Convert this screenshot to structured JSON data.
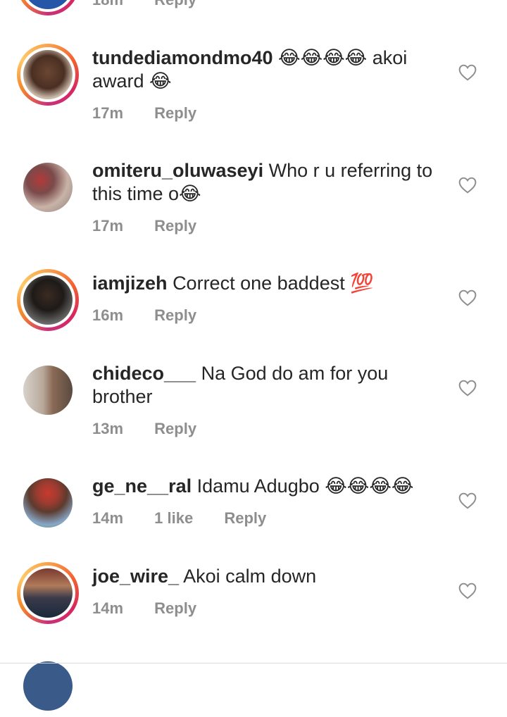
{
  "top_partial": {
    "time": "18m",
    "reply": "Reply"
  },
  "comments": [
    {
      "user": "tundediamondmo40",
      "text": "😂😂😂😂 akoi award 😂",
      "time": "17m",
      "likes": "",
      "reply": "Reply",
      "story": true
    },
    {
      "user": "omiteru_oluwaseyi",
      "text": "Who r u referring to this time o😂",
      "time": "17m",
      "likes": "",
      "reply": "Reply",
      "story": false
    },
    {
      "user": "iamjizeh",
      "text": "Correct one baddest 💯",
      "time": "16m",
      "likes": "",
      "reply": "Reply",
      "story": true
    },
    {
      "user": "chideco___",
      "text": "Na God do am for you brother",
      "time": "13m",
      "likes": "",
      "reply": "Reply",
      "story": false
    },
    {
      "user": "ge_ne__ral",
      "text": "Idamu Adugbo 😂😂😂😂",
      "time": "14m",
      "likes": "1 like",
      "reply": "Reply",
      "story": false
    },
    {
      "user": "joe_wire_",
      "text": "Akoi calm down",
      "time": "14m",
      "likes": "",
      "reply": "Reply",
      "story": true
    }
  ],
  "icons": {
    "like": "heart-outline-icon"
  },
  "colors": {
    "meta": "#8e8e8e",
    "text": "#262626",
    "heart": "#8e8e8e"
  }
}
